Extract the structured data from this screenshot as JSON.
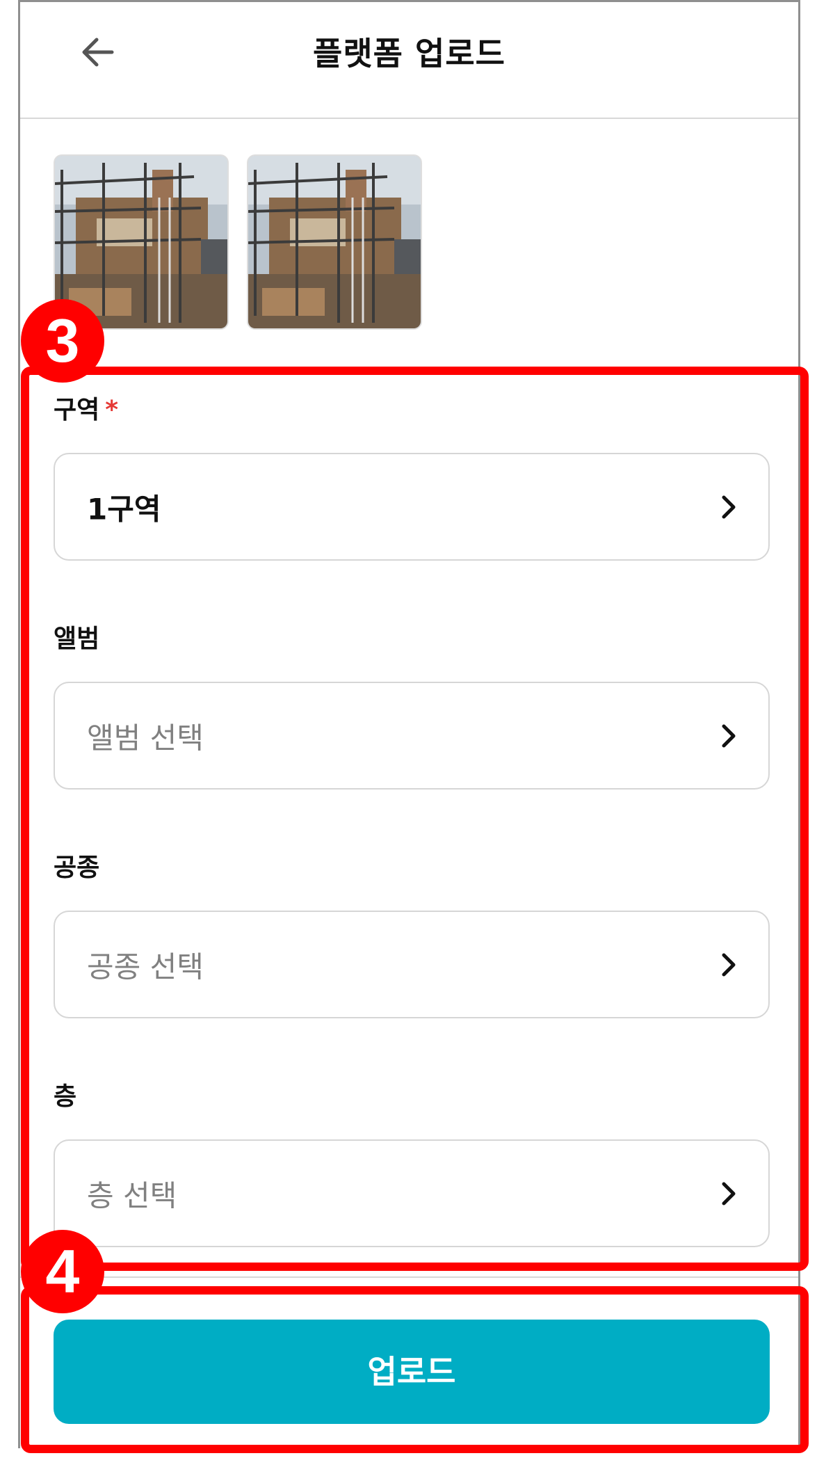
{
  "header": {
    "title": "플랫폼 업로드",
    "back_icon": "arrow-left-icon"
  },
  "photos": [
    {
      "alt_icon": "construction-photo"
    },
    {
      "alt_icon": "construction-photo"
    }
  ],
  "form": {
    "zone": {
      "label": "구역",
      "required_mark": "*",
      "value": "1구역"
    },
    "album": {
      "label": "앨범",
      "placeholder": "앨범 선택"
    },
    "trade": {
      "label": "공종",
      "placeholder": "공종 선택"
    },
    "floor": {
      "label": "층",
      "placeholder": "층 선택"
    }
  },
  "upload_button": {
    "label": "업로드"
  },
  "annotations": {
    "badge_3": "3",
    "badge_4": "4",
    "color": "#ff0000"
  },
  "colors": {
    "accent": "#00adc4",
    "required": "#e53935"
  }
}
